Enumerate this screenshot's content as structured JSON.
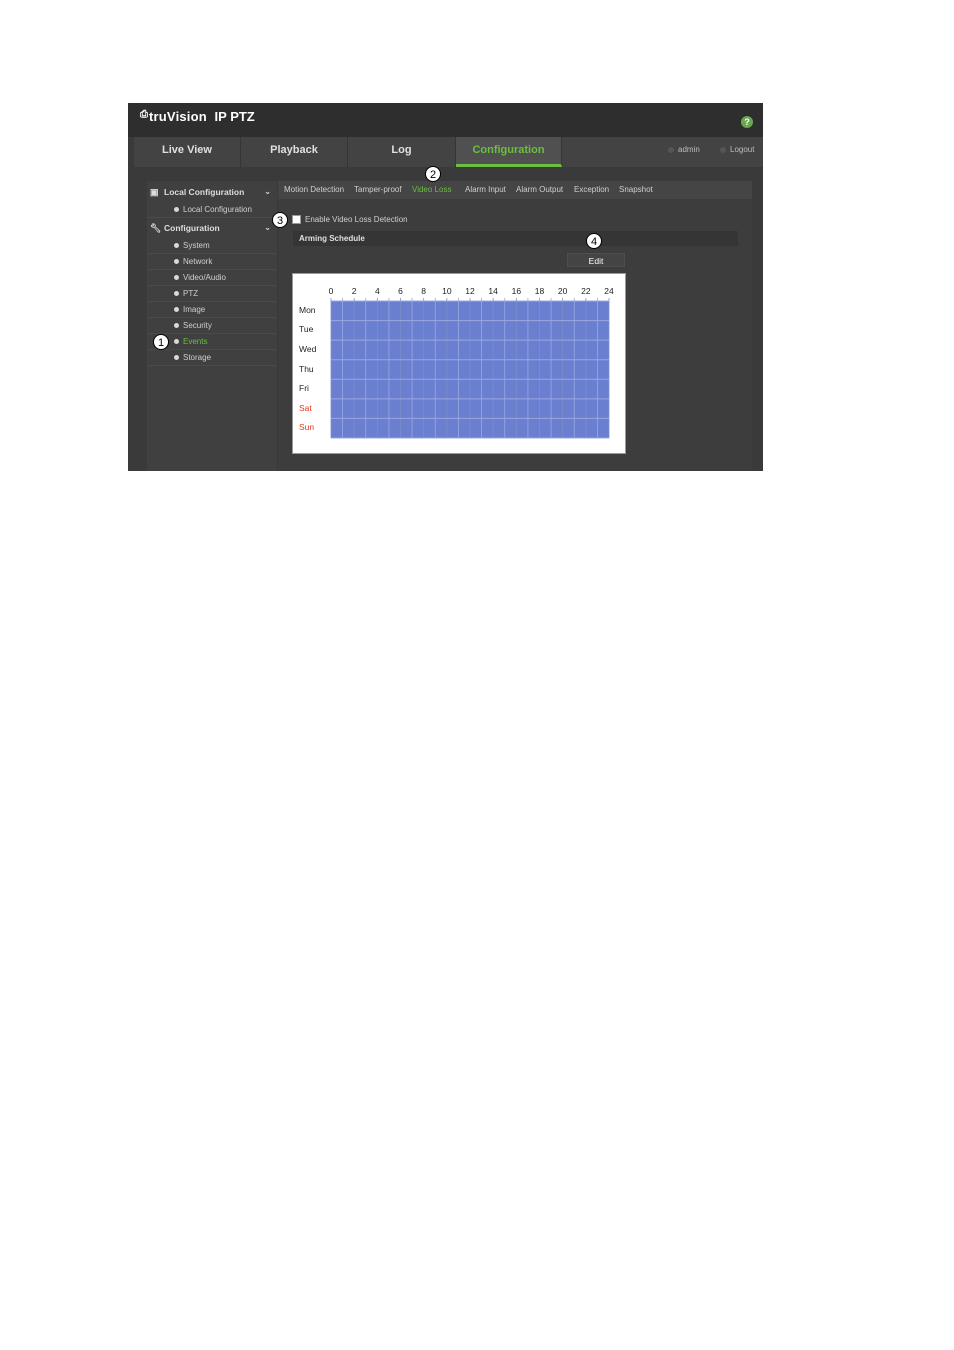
{
  "app": {
    "brand": "truVision",
    "product": "IP PTZ",
    "help_icon": "question-circle-icon",
    "help_glyph": "?"
  },
  "nav": {
    "tabs": [
      {
        "label": "Live View"
      },
      {
        "label": "Playback"
      },
      {
        "label": "Log"
      },
      {
        "label": "Configuration",
        "active": true
      }
    ],
    "user": "admin",
    "logout": "Logout"
  },
  "sidebar": {
    "local_group": {
      "label": "Local Configuration",
      "icon": "monitor-icon"
    },
    "local_items": [
      {
        "label": "Local Configuration"
      }
    ],
    "config_group": {
      "label": "Configuration",
      "icon": "wrench-icon"
    },
    "config_items": [
      {
        "label": "System"
      },
      {
        "label": "Network"
      },
      {
        "label": "Video/Audio"
      },
      {
        "label": "PTZ"
      },
      {
        "label": "Image"
      },
      {
        "label": "Security"
      },
      {
        "label": "Events",
        "active": true
      },
      {
        "label": "Storage"
      }
    ]
  },
  "subtabs": [
    {
      "label": "Motion Detection"
    },
    {
      "label": "Tamper-proof"
    },
    {
      "label": "Video Loss",
      "active": true
    },
    {
      "label": "Alarm Input"
    },
    {
      "label": "Alarm Output"
    },
    {
      "label": "Exception"
    },
    {
      "label": "Snapshot"
    }
  ],
  "enable_label": "Enable Video Loss Detection",
  "arming_schedule": {
    "title": "Arming Schedule",
    "edit_label": "Edit",
    "hours": [
      "0",
      "2",
      "4",
      "6",
      "8",
      "10",
      "12",
      "14",
      "16",
      "18",
      "20",
      "22",
      "24"
    ],
    "days": [
      {
        "label": "Mon",
        "weekend": false
      },
      {
        "label": "Tue",
        "weekend": false
      },
      {
        "label": "Wed",
        "weekend": false
      },
      {
        "label": "Thu",
        "weekend": false
      },
      {
        "label": "Fri",
        "weekend": false
      },
      {
        "label": "Sat",
        "weekend": true
      },
      {
        "label": "Sun",
        "weekend": true
      }
    ],
    "fill_color": "#6a7fd0",
    "line_color": "#9aa8e0"
  },
  "callouts": {
    "events": "1",
    "video_loss": "2",
    "enable": "3",
    "edit": "4"
  }
}
